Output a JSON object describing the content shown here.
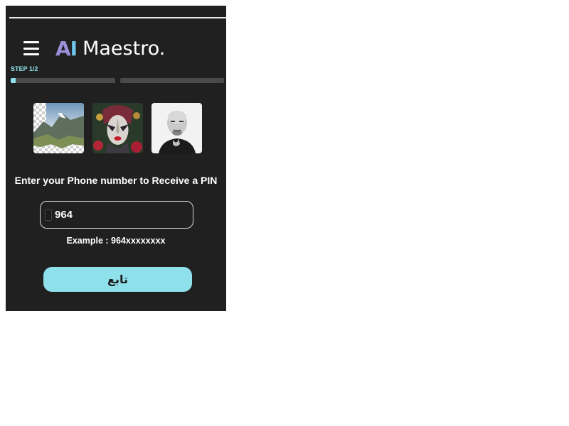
{
  "header": {
    "logo_ai": [
      "A",
      "I"
    ],
    "logo_text": "Maestro.",
    "menu_icon": "hamburger-menu-icon"
  },
  "progress": {
    "step_label": "STEP 1/2",
    "bar1_fill": 0.05,
    "bar2_fill": 0
  },
  "thumbnails": [
    "mountain-landscape-transparent-image",
    "masked-woman-portrait-image",
    "bald-man-portrait-image"
  ],
  "form": {
    "heading": "Enter your Phone number to Receive a PIN",
    "phone_value": "964",
    "example": "Example : 964xxxxxxxx",
    "continue_label": "تابع"
  },
  "colors": {
    "panel_bg": "#202020",
    "accent": "#8ee0ea",
    "logo_a": "#9a8fd8",
    "logo_i": "#6ec6ea"
  }
}
